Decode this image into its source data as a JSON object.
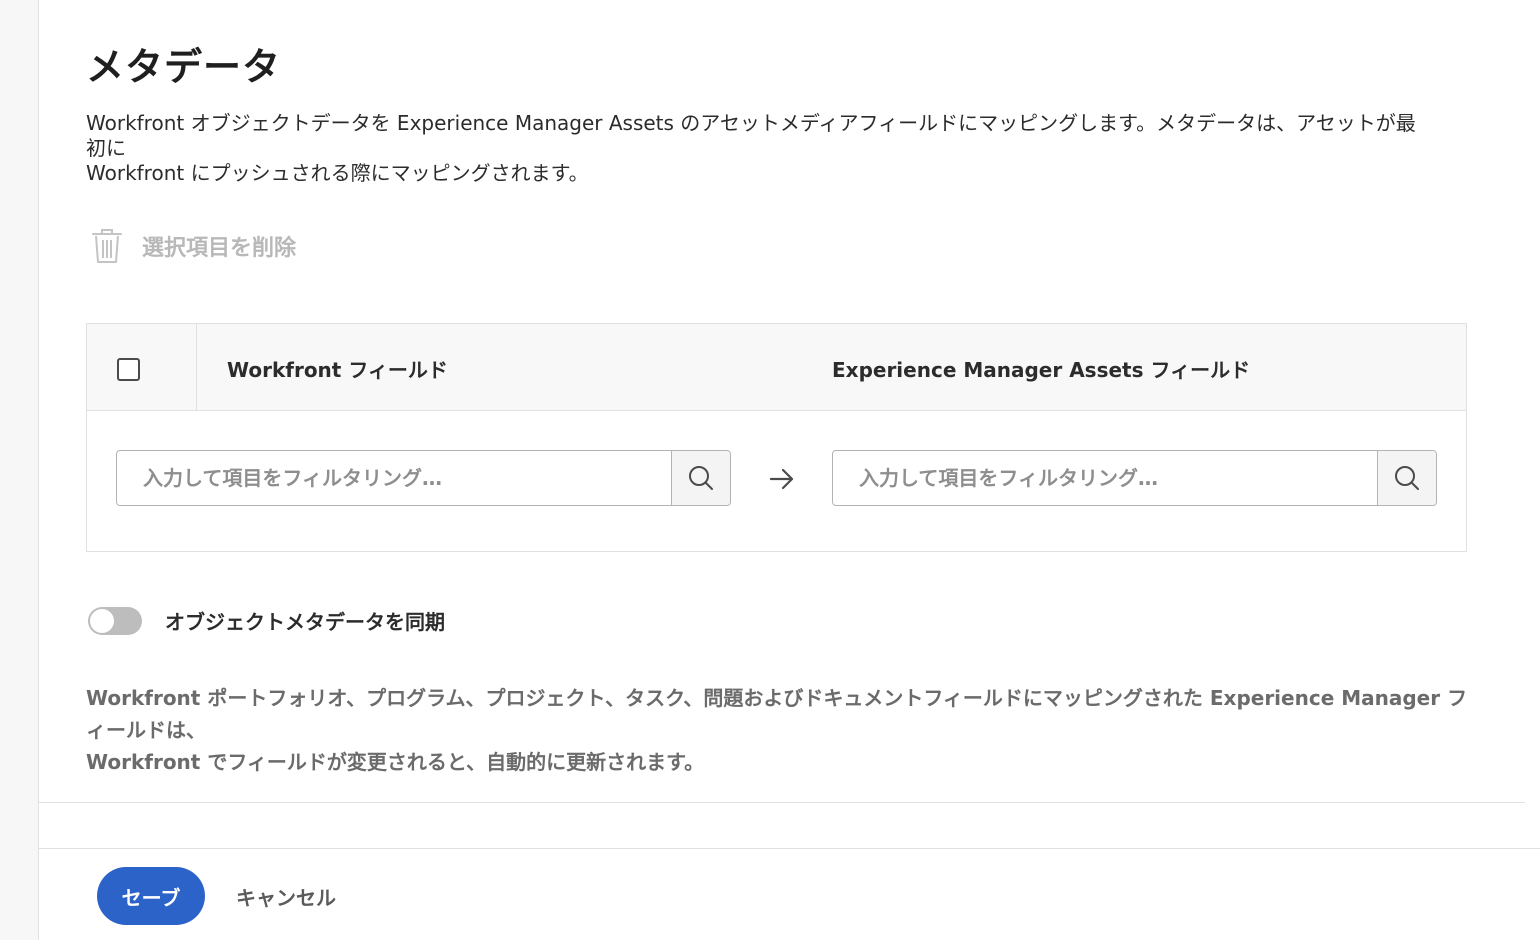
{
  "page": {
    "title": "メタデータ",
    "description_line1": "Workfront オブジェクトデータを Experience Manager Assets のアセットメディアフィールドにマッピングします。メタデータは、アセットが最初に",
    "description_line2": "Workfront にプッシュされる際にマッピングされます。"
  },
  "toolbar": {
    "delete_selected_label": "選択項目を削除",
    "delete_icon": "trash-icon"
  },
  "mapping_table": {
    "columns": [
      "Workfront フィールド",
      "Experience Manager Assets フィールド"
    ],
    "workfront_filter": {
      "value": "",
      "placeholder": "入力して項目をフィルタリング…"
    },
    "aem_filter": {
      "value": "",
      "placeholder": "入力して項目をフィルタリング…"
    },
    "select_all_checked": false
  },
  "sync": {
    "label": "オブジェクトメタデータを同期",
    "enabled": false,
    "note_line1": "Workfront ポートフォリオ、プログラム、プロジェクト、タスク、問題およびドキュメントフィールドにマッピングされた Experience Manager フィールドは、",
    "note_line2": "Workfront でフィールドが変更されると、自動的に更新されます。"
  },
  "footer": {
    "save_label": "セーブ",
    "cancel_label": "キャンセル"
  },
  "colors": {
    "accent": "#2c63c9",
    "disabled_text": "#b8b8b8",
    "toggle_off": "#bdbdbd"
  }
}
